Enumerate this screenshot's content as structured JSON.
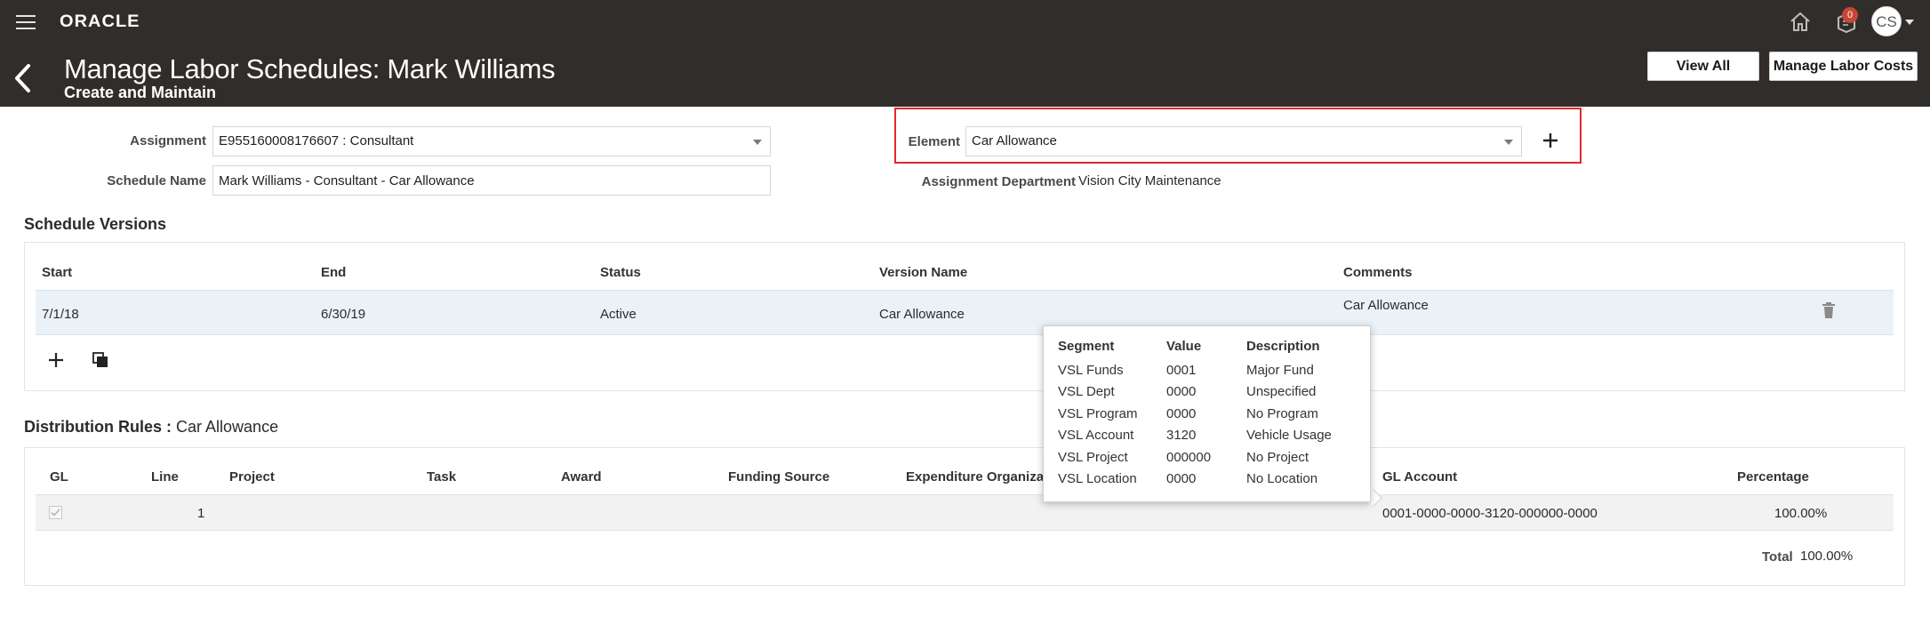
{
  "header": {
    "logo_text": "ORACLE",
    "notification_count": "0",
    "user_initials": "CS",
    "title": "Manage Labor Schedules: Mark Williams",
    "subtitle": "Create and Maintain",
    "buttons": {
      "view_all": "View All",
      "manage_labor_costs": "Manage Labor Costs"
    },
    "icons": [
      "hamburger-menu-icon",
      "home-icon",
      "notifications-icon",
      "back-chevron-icon"
    ]
  },
  "form": {
    "assignment_label": "Assignment",
    "assignment_value": "E955160008176607 : Consultant",
    "schedule_name_label": "Schedule Name",
    "schedule_name_value": "Mark Williams - Consultant - Car Allowance",
    "element_label": "Element",
    "element_value": "Car Allowance",
    "assignment_department_label": "Assignment Department",
    "assignment_department_value": "Vision City Maintenance"
  },
  "schedule_versions": {
    "title": "Schedule Versions",
    "columns": [
      "Start",
      "End",
      "Status",
      "Version Name",
      "Comments"
    ],
    "rows": [
      {
        "start": "7/1/18",
        "end": "6/30/19",
        "status": "Active",
        "version_name": "Car Allowance",
        "comments": "Car Allowance"
      }
    ],
    "icons": [
      "add-icon",
      "duplicate-icon",
      "delete-icon"
    ]
  },
  "distribution_rules": {
    "title": "Distribution Rules :",
    "title_value": "Car Allowance",
    "columns": [
      "GL",
      "Line",
      "Project",
      "Task",
      "Award",
      "Funding Source",
      "Expenditure Organizat",
      "GL Account",
      "Percentage"
    ],
    "rows": [
      {
        "gl_checked": true,
        "line": "1",
        "gl_account": "0001-0000-0000-3120-000000-0000",
        "percentage": "100.00%"
      }
    ],
    "total_label": "Total",
    "total_value": "100.00%"
  },
  "gl_popup": {
    "columns": [
      "Segment",
      "Value",
      "Description"
    ],
    "rows": [
      {
        "segment": "VSL Funds",
        "value": "0001",
        "description": "Major Fund"
      },
      {
        "segment": "VSL Dept",
        "value": "0000",
        "description": "Unspecified"
      },
      {
        "segment": "VSL Program",
        "value": "0000",
        "description": "No Program"
      },
      {
        "segment": "VSL Account",
        "value": "3120",
        "description": "Vehicle Usage"
      },
      {
        "segment": "VSL Project",
        "value": "000000",
        "description": "No Project"
      },
      {
        "segment": "VSL Location",
        "value": "0000",
        "description": "No Location"
      }
    ]
  },
  "colors": {
    "header_bg": "#312d2a",
    "highlight_border": "#e0282a",
    "badge": "#c74634",
    "selected_row": "#eaf2f8",
    "distribution_row": "#f2f2f2"
  }
}
